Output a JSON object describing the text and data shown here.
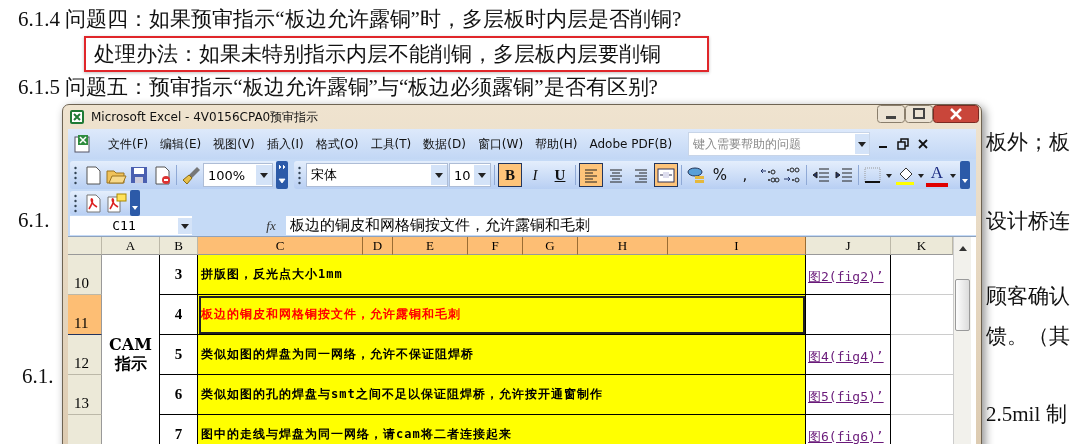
{
  "document": {
    "lines": [
      {
        "text": "6.1.4 问题四：如果预审指示“板边允许露铜”时，多层板时内层是否削铜?",
        "boxed": false
      },
      {
        "text": "处理办法：如果未特别指示内层不能削铜，多层板内层要削铜",
        "boxed": true
      },
      {
        "text": "6.1.5 问题五：预审指示“板边允许露铜”与“板边必须露铜”是否有区别?",
        "boxed": false
      }
    ],
    "left_fragments": [
      "6.1.",
      "6.1."
    ],
    "right_fragments": [
      "板外；板",
      "设计桥连",
      "顾客确认",
      "馈。（其",
      "2.5mil 制"
    ]
  },
  "excel": {
    "title": "Microsoft Excel - 4V0156CPA0预审指示",
    "menu": [
      "文件(F)",
      "编辑(E)",
      "视图(V)",
      "插入(I)",
      "格式(O)",
      "工具(T)",
      "数据(D)",
      "窗口(W)",
      "帮助(H)",
      "Adobe PDF(B)"
    ],
    "help_placeholder": "键入需要帮助的问题",
    "zoom": "100%",
    "font": "宋体",
    "font_size": "10",
    "toggles": [
      {
        "kind": "bold",
        "label": "B",
        "selected": true
      },
      {
        "kind": "italic",
        "label": "I",
        "selected": false
      },
      {
        "kind": "underline",
        "label": "U",
        "selected": false
      },
      {
        "kind": "align-left",
        "selected": true
      },
      {
        "kind": "align-center",
        "selected": false
      },
      {
        "kind": "align-right",
        "selected": false
      },
      {
        "kind": "merge",
        "selected": true
      }
    ],
    "number_buttons": [
      "%",
      ","
    ],
    "font_color_label": "A",
    "name_box": "C11",
    "function_label": "fx",
    "formula": "板边的铜皮和网格铜按文件，允许露铜和毛刺",
    "columns": [
      {
        "label": "A",
        "selected": false
      },
      {
        "label": "B",
        "selected": false
      },
      {
        "label": "C",
        "selected": true
      },
      {
        "label": "D",
        "selected": true
      },
      {
        "label": "E",
        "selected": true
      },
      {
        "label": "F",
        "selected": true
      },
      {
        "label": "G",
        "selected": true
      },
      {
        "label": "H",
        "selected": true
      },
      {
        "label": "I",
        "selected": true
      },
      {
        "label": "J",
        "selected": false
      },
      {
        "label": "K",
        "selected": false
      }
    ],
    "category": "CAM 指示",
    "rows": [
      {
        "header": "10",
        "selected": false,
        "number": "3",
        "text": "拼版图，反光点大小1mm",
        "color": "#000000",
        "link": "图2(fig2)’"
      },
      {
        "header": "11",
        "selected": true,
        "number": "4",
        "text": "板边的铜皮和网格铜按文件，允许露铜和毛刺",
        "color": "#ff0000"
      },
      {
        "header": "12",
        "selected": false,
        "number": "5",
        "text": "类似如图的焊盘为同一网络，允许不保证阻焊桥",
        "color": "#000000",
        "link": "图4(fig4)’"
      },
      {
        "header": "13",
        "selected": false,
        "number": "6",
        "text": "类似如图的孔的焊盘与smt之间不足以保证阻焊桥，允许按开通窗制作",
        "color": "#000000",
        "link": "图5(fig5)’"
      },
      {
        "selected": false,
        "number": "7",
        "text": "图中的走线与焊盘为同一网络，请cam将二者连接起来",
        "color": "#000000",
        "link": "图6(fig6)’"
      }
    ]
  }
}
